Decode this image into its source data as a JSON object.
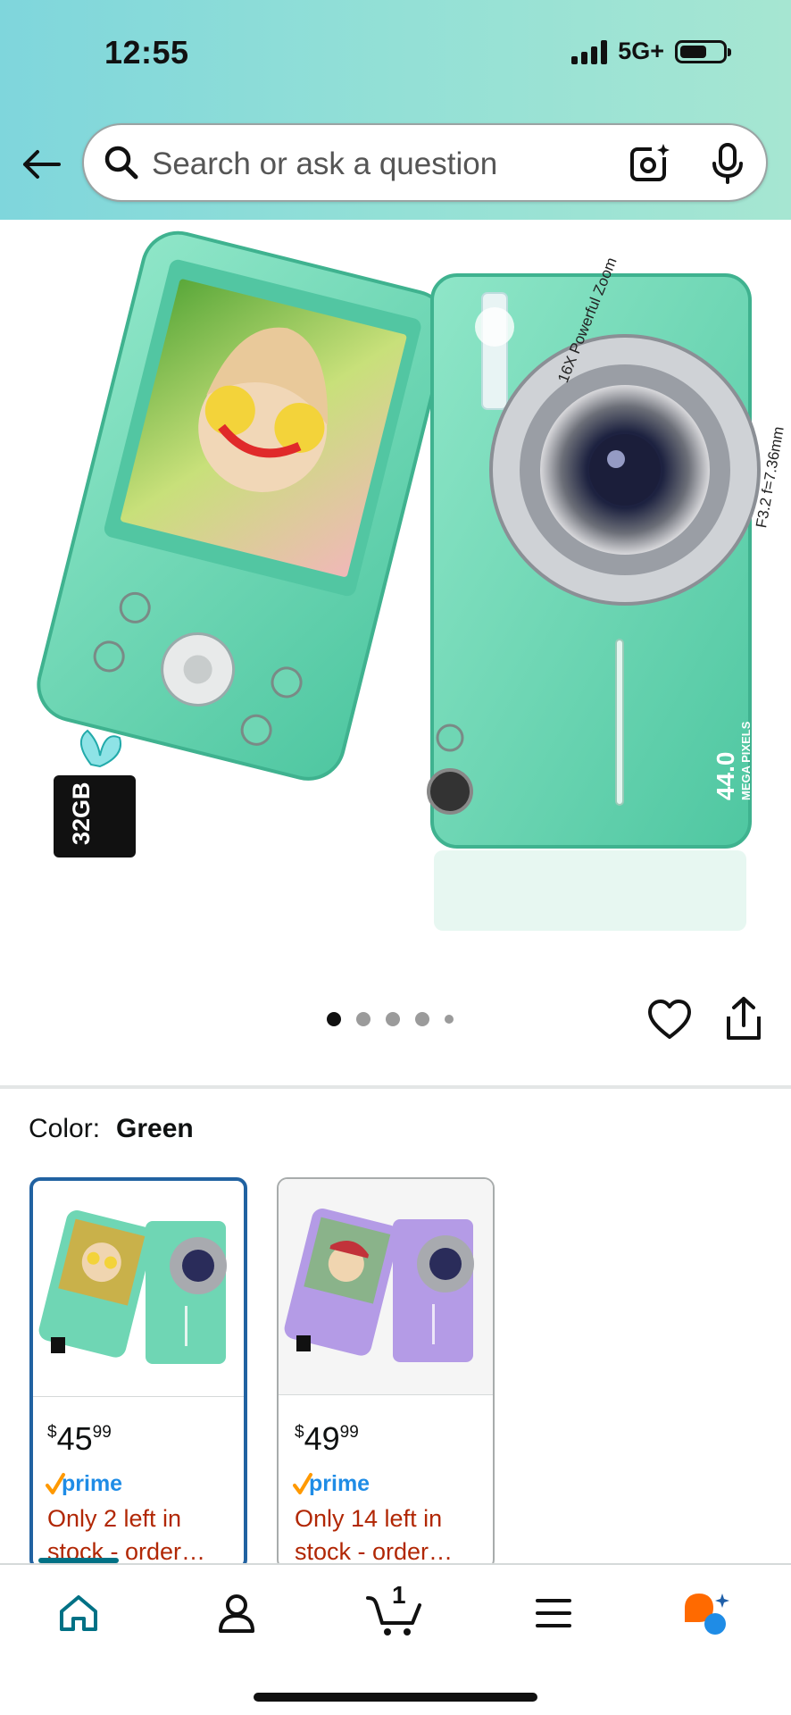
{
  "status_bar": {
    "time": "12:55",
    "network": "5G+"
  },
  "search": {
    "placeholder": "Search or ask a question"
  },
  "product_image": {
    "carousel": {
      "total": 5,
      "active_index": 0
    },
    "overlay": {
      "zoom_text": "16X Powerful Zoom",
      "focal_text": "F3.2 f=7.36mm",
      "megapixels": "44.0",
      "megapixels_label": "MEGA PIXELS",
      "sd_card": "32GB"
    }
  },
  "variation": {
    "label": "Color:",
    "selected": "Green",
    "options": [
      {
        "name": "Green",
        "price_whole": "45",
        "price_fraction": "99",
        "currency": "$",
        "stock": "Only 2 left in stock - order…",
        "color": "#6fd6b4"
      },
      {
        "name": "Purple",
        "price_whole": "49",
        "price_fraction": "99",
        "currency": "$",
        "stock": "Only 14 left in stock - order…",
        "color": "#b49be6"
      }
    ]
  },
  "badge": {
    "prime": "prime"
  },
  "bottom_nav": {
    "cart_count": "1",
    "items": [
      "home",
      "account",
      "cart",
      "menu",
      "rufus"
    ]
  },
  "colors": {
    "accent": "#007185",
    "selected_border": "#2162a1",
    "stock_red": "#b12704",
    "prime_blue": "#1f8ce6"
  }
}
